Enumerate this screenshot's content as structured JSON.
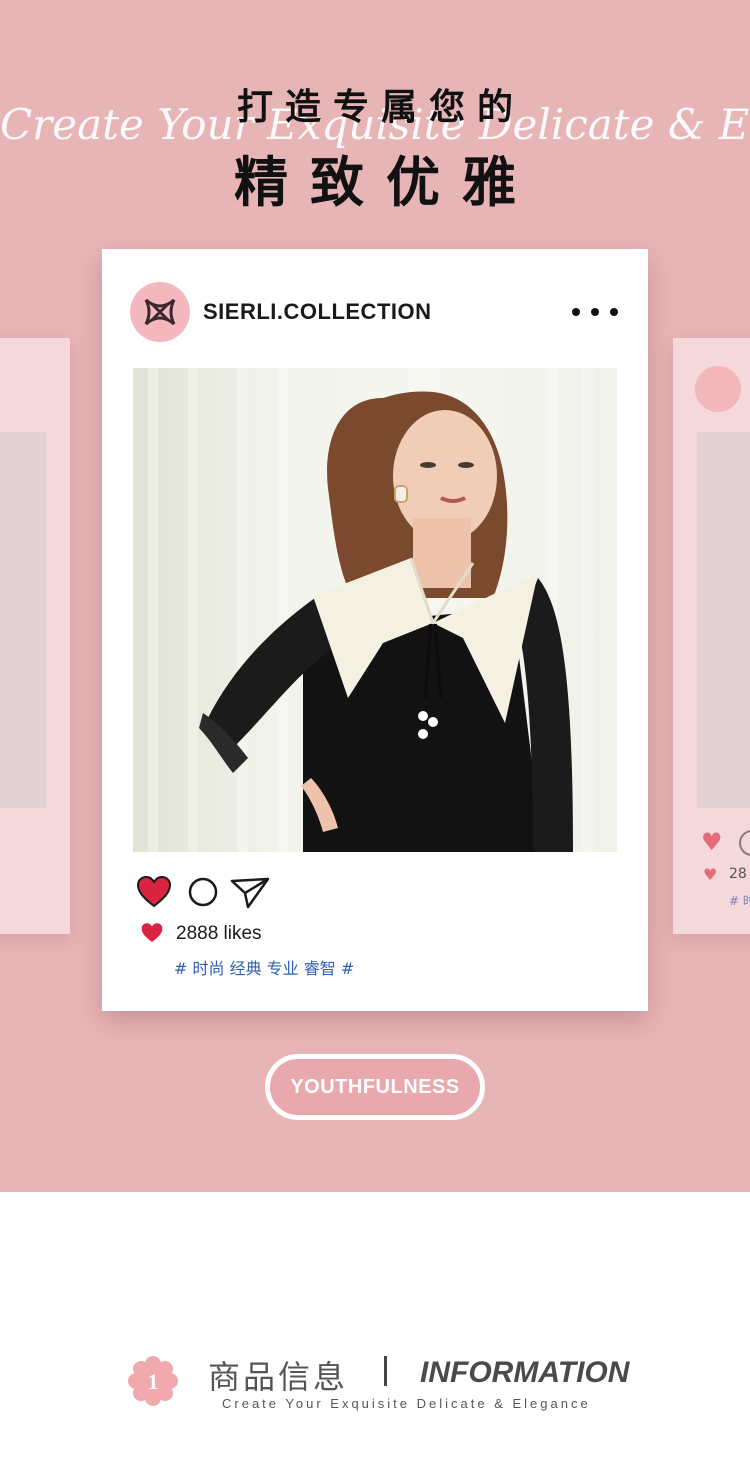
{
  "hero": {
    "script_text": "Create Your Exquisite Delicate & Elegance",
    "title_line1": "打造专属您的",
    "title_line2": "精致优雅",
    "background": "#e8b5b7"
  },
  "post": {
    "username": "SIERLI.COLLECTION",
    "more_icon": "more-dots-icon",
    "likes_text": "2888 likes",
    "hashtags": "# 时尚 经典 专业 睿智 #",
    "actions": [
      "heart-icon",
      "comment-icon",
      "send-icon"
    ]
  },
  "right_card": {
    "likes_partial": "28",
    "tag_partial": "# 时"
  },
  "cta": {
    "label": "YOUTHFULNESS"
  },
  "info": {
    "badge_number": "1",
    "title_cn": "商品信息",
    "title_en": "INFORMATION",
    "subtitle": "Create Your Exquisite Delicate & Elegance"
  },
  "colors": {
    "accent_pink": "#e8a8ad",
    "heart_red": "#d8243f",
    "tag_blue": "#2f5fb3"
  }
}
